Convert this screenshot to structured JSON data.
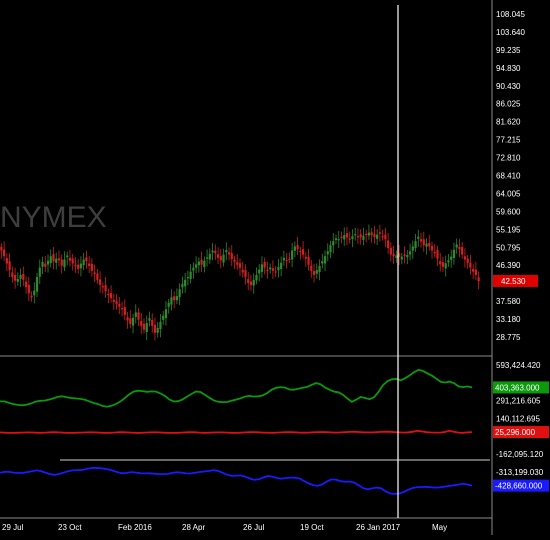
{
  "chart_data": {
    "type": "line",
    "watermark": "NYMEX",
    "x_labels": [
      "29 Jul",
      "23 Oct",
      "Feb 2016",
      "28 Apr",
      "26 Jul",
      "19 Oct",
      "26 Jan 2017",
      "May"
    ],
    "price_panel": {
      "y_ticks": [
        "108.045",
        "103.640",
        "99.235",
        "94.830",
        "90.430",
        "86.025",
        "81.620",
        "77.215",
        "72.810",
        "68.410",
        "64.005",
        "59.600",
        "55.195",
        "50.795",
        "46.390",
        "37.580",
        "33.180",
        "28.775"
      ],
      "y_tick_values": [
        108.045,
        103.64,
        99.235,
        94.83,
        90.43,
        86.025,
        81.62,
        77.215,
        72.81,
        68.41,
        64.005,
        59.6,
        55.195,
        50.795,
        46.39,
        37.58,
        33.18,
        28.775
      ],
      "ylim": [
        28.775,
        108.045
      ],
      "last_price": "42.530",
      "last_price_value": 42.53,
      "up_color": "#2e8b2e",
      "down_color": "#d42020",
      "candles_close": [
        50.0,
        48.6,
        46.8,
        45.2,
        43.5,
        42.6,
        43.0,
        44.0,
        42.8,
        41.0,
        39.5,
        38.5,
        40.2,
        43.5,
        45.8,
        47.2,
        46.0,
        47.5,
        48.6,
        47.3,
        48.0,
        47.6,
        46.3,
        47.8,
        48.8,
        47.5,
        46.8,
        46.4,
        45.5,
        46.8,
        47.8,
        47.4,
        46.2,
        45.0,
        44.2,
        42.8,
        41.6,
        41.0,
        40.0,
        39.0,
        38.3,
        37.4,
        36.8,
        36.2,
        35.6,
        34.2,
        32.8,
        32.0,
        33.5,
        34.8,
        33.0,
        31.5,
        30.6,
        32.2,
        33.4,
        31.5,
        29.8,
        31.0,
        32.5,
        34.0,
        35.6,
        37.2,
        38.5,
        37.8,
        38.8,
        40.5,
        41.8,
        42.8,
        43.5,
        44.8,
        45.8,
        46.6,
        47.3,
        46.5,
        47.5,
        48.3,
        49.2,
        50.0,
        49.3,
        48.2,
        47.6,
        49.0,
        50.1,
        49.0,
        47.9,
        47.3,
        46.5,
        45.8,
        44.6,
        43.5,
        42.0,
        41.5,
        42.8,
        44.0,
        45.3,
        46.6,
        45.8,
        45.0,
        45.8,
        45.0,
        44.8,
        46.0,
        47.0,
        48.2,
        47.6,
        48.0,
        50.0,
        51.0,
        50.4,
        49.7,
        49.0,
        48.0,
        46.5,
        45.0,
        44.0,
        45.2,
        46.2,
        47.4,
        48.6,
        49.8,
        51.3,
        52.3,
        53.0,
        52.8,
        53.3,
        53.8,
        53.2,
        52.8,
        53.5,
        54.0,
        53.4,
        53.2,
        53.6,
        54.0,
        54.4,
        53.8,
        53.3,
        53.9,
        54.1,
        53.4,
        52.8,
        50.6,
        49.0,
        48.6,
        48.8,
        48.4,
        48.5,
        48.7,
        48.9,
        49.8,
        51.0,
        52.3,
        53.4,
        52.2,
        51.3,
        51.7,
        51.0,
        50.0,
        49.6,
        48.0,
        46.6,
        46.0,
        46.9,
        47.6,
        48.5,
        50.2,
        51.5,
        50.3,
        49.0,
        47.8,
        46.9,
        45.8,
        44.8,
        44.0,
        42.5
      ]
    },
    "open_interest_panel": {
      "y_ticks": [
        "593,424.420",
        "291,216.605",
        "140,112.695",
        "-162,095.120",
        "-313,199.030"
      ],
      "y_tick_values": [
        593424.42,
        291216.605,
        140112.695,
        -162095.12,
        -313199.03
      ],
      "ylim": [
        -640000,
        680000
      ],
      "series": [
        {
          "color": "#0a9a0a",
          "last_label": "403,363.000",
          "last": 403363,
          "values": [
            285000,
            285000,
            272000,
            262000,
            255000,
            252000,
            258000,
            268000,
            283000,
            290000,
            292000,
            300000,
            310000,
            325000,
            328000,
            320000,
            314000,
            310000,
            306000,
            300000,
            286000,
            272000,
            262000,
            247000,
            240000,
            248000,
            262000,
            283000,
            312000,
            344000,
            368000,
            376000,
            372000,
            366000,
            370000,
            368000,
            353000,
            332000,
            302000,
            284000,
            287000,
            302000,
            326000,
            348000,
            368000,
            365000,
            342000,
            316000,
            294000,
            282000,
            278000,
            280000,
            290000,
            300000,
            310000,
            326000,
            332000,
            326000,
            328000,
            336000,
            356000,
            383000,
            400000,
            406000,
            402000,
            386000,
            384000,
            393000,
            400000,
            408000,
            426000,
            440000,
            430000,
            402000,
            384000,
            368000,
            362000,
            342000,
            310000,
            282000,
            300000,
            322000,
            314000,
            304000,
            320000,
            365000,
            422000,
            456000,
            472000,
            476000,
            464000,
            482000,
            505000,
            532000,
            553000,
            543000,
            522000,
            503000,
            478000,
            450000,
            445000,
            453000,
            438000,
            412000,
            406000,
            412000,
            404000
          ]
        },
        {
          "color": "#e01010",
          "last_label": "25,296.000",
          "last": 25296,
          "values": [
            22000,
            20000,
            18500,
            18500,
            19500,
            21000,
            22000,
            21500,
            20000,
            19000,
            20500,
            23000,
            24000,
            22000,
            20000,
            19000,
            18500,
            19500,
            21000,
            22500,
            23000,
            22000,
            19500,
            18000,
            19000,
            21000,
            23000,
            24000,
            22500,
            20000,
            18500,
            19000,
            20500,
            22000,
            23000,
            22000,
            20000,
            18500,
            18000,
            19000,
            21000,
            23000,
            24500,
            23000,
            20500,
            19000,
            20000,
            21500,
            22500,
            22000,
            20500,
            19000,
            18500,
            20000,
            22000,
            24000,
            25000,
            23500,
            21000,
            19500,
            19000,
            20500,
            22500,
            24000,
            24500,
            23000,
            21000,
            20000,
            21000,
            23000,
            25000,
            26000,
            24500,
            22000,
            21000,
            22500,
            24500,
            26500,
            27500,
            26000,
            23500,
            22000,
            22500,
            24500,
            26500,
            28000,
            27000,
            24000,
            22000,
            21000,
            23500,
            28000,
            36000,
            30000,
            24000,
            21500,
            20500,
            21000,
            26000,
            36000,
            28000,
            21000,
            19000,
            22000,
            25296
          ]
        },
        {
          "color": "#1a1aff",
          "last_label": "-428,660.000",
          "last": -428660,
          "values": [
            -320000,
            -312000,
            -312000,
            -318000,
            -322000,
            -320000,
            -315000,
            -306000,
            -300000,
            -305000,
            -318000,
            -330000,
            -338000,
            -330000,
            -318000,
            -306000,
            -300000,
            -297000,
            -296000,
            -289000,
            -280000,
            -278000,
            -281000,
            -285000,
            -292000,
            -304000,
            -317000,
            -324000,
            -321000,
            -314000,
            -318000,
            -324000,
            -325000,
            -324000,
            -328000,
            -331000,
            -331000,
            -329000,
            -321000,
            -316000,
            -318000,
            -325000,
            -326000,
            -319000,
            -313000,
            -309000,
            -305000,
            -298000,
            -303000,
            -319000,
            -336000,
            -345000,
            -344000,
            -342000,
            -352000,
            -368000,
            -379000,
            -375000,
            -360000,
            -348000,
            -352000,
            -363000,
            -370000,
            -365000,
            -360000,
            -362000,
            -368000,
            -390000,
            -410000,
            -424000,
            -430000,
            -418000,
            -394000,
            -376000,
            -378000,
            -390000,
            -395000,
            -394000,
            -402000,
            -425000,
            -450000,
            -460000,
            -452000,
            -445000,
            -452000,
            -478000,
            -495000,
            -498000,
            -495000,
            -482000,
            -462000,
            -448000,
            -441000,
            -440000,
            -439000,
            -443000,
            -445000,
            -443000,
            -437000,
            -431000,
            -426000,
            -420000,
            -413000,
            -419000,
            -428660
          ]
        }
      ]
    }
  }
}
